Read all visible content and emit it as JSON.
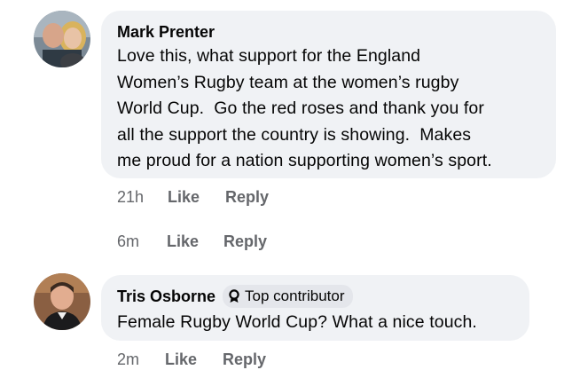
{
  "comments": [
    {
      "author": "Mark Prenter",
      "text_lines": [
        "Love this, what support for the England",
        "Women’s Rugby team at the women’s rugby",
        "World Cup.  Go the red roses and thank you for",
        "all the support the country is showing.  Makes",
        "me proud for a nation supporting women’s sport."
      ],
      "time": "21h",
      "like_label": "Like",
      "reply_label": "Reply"
    },
    {
      "author": "",
      "time": "6m",
      "like_label": "Like",
      "reply_label": "Reply"
    },
    {
      "author": "Tris Osborne",
      "badge": "Top contributor",
      "badge_icon": "award-ribbon-icon",
      "text_lines": [
        "Female Rugby World Cup? What a nice touch."
      ],
      "time": "2m",
      "like_label": "Like",
      "reply_label": "Reply"
    }
  ],
  "colors": {
    "bubble_bg": "#f0f2f5",
    "meta_text": "#65676b",
    "badge_bg": "#e4e6eb",
    "text": "#050505"
  }
}
